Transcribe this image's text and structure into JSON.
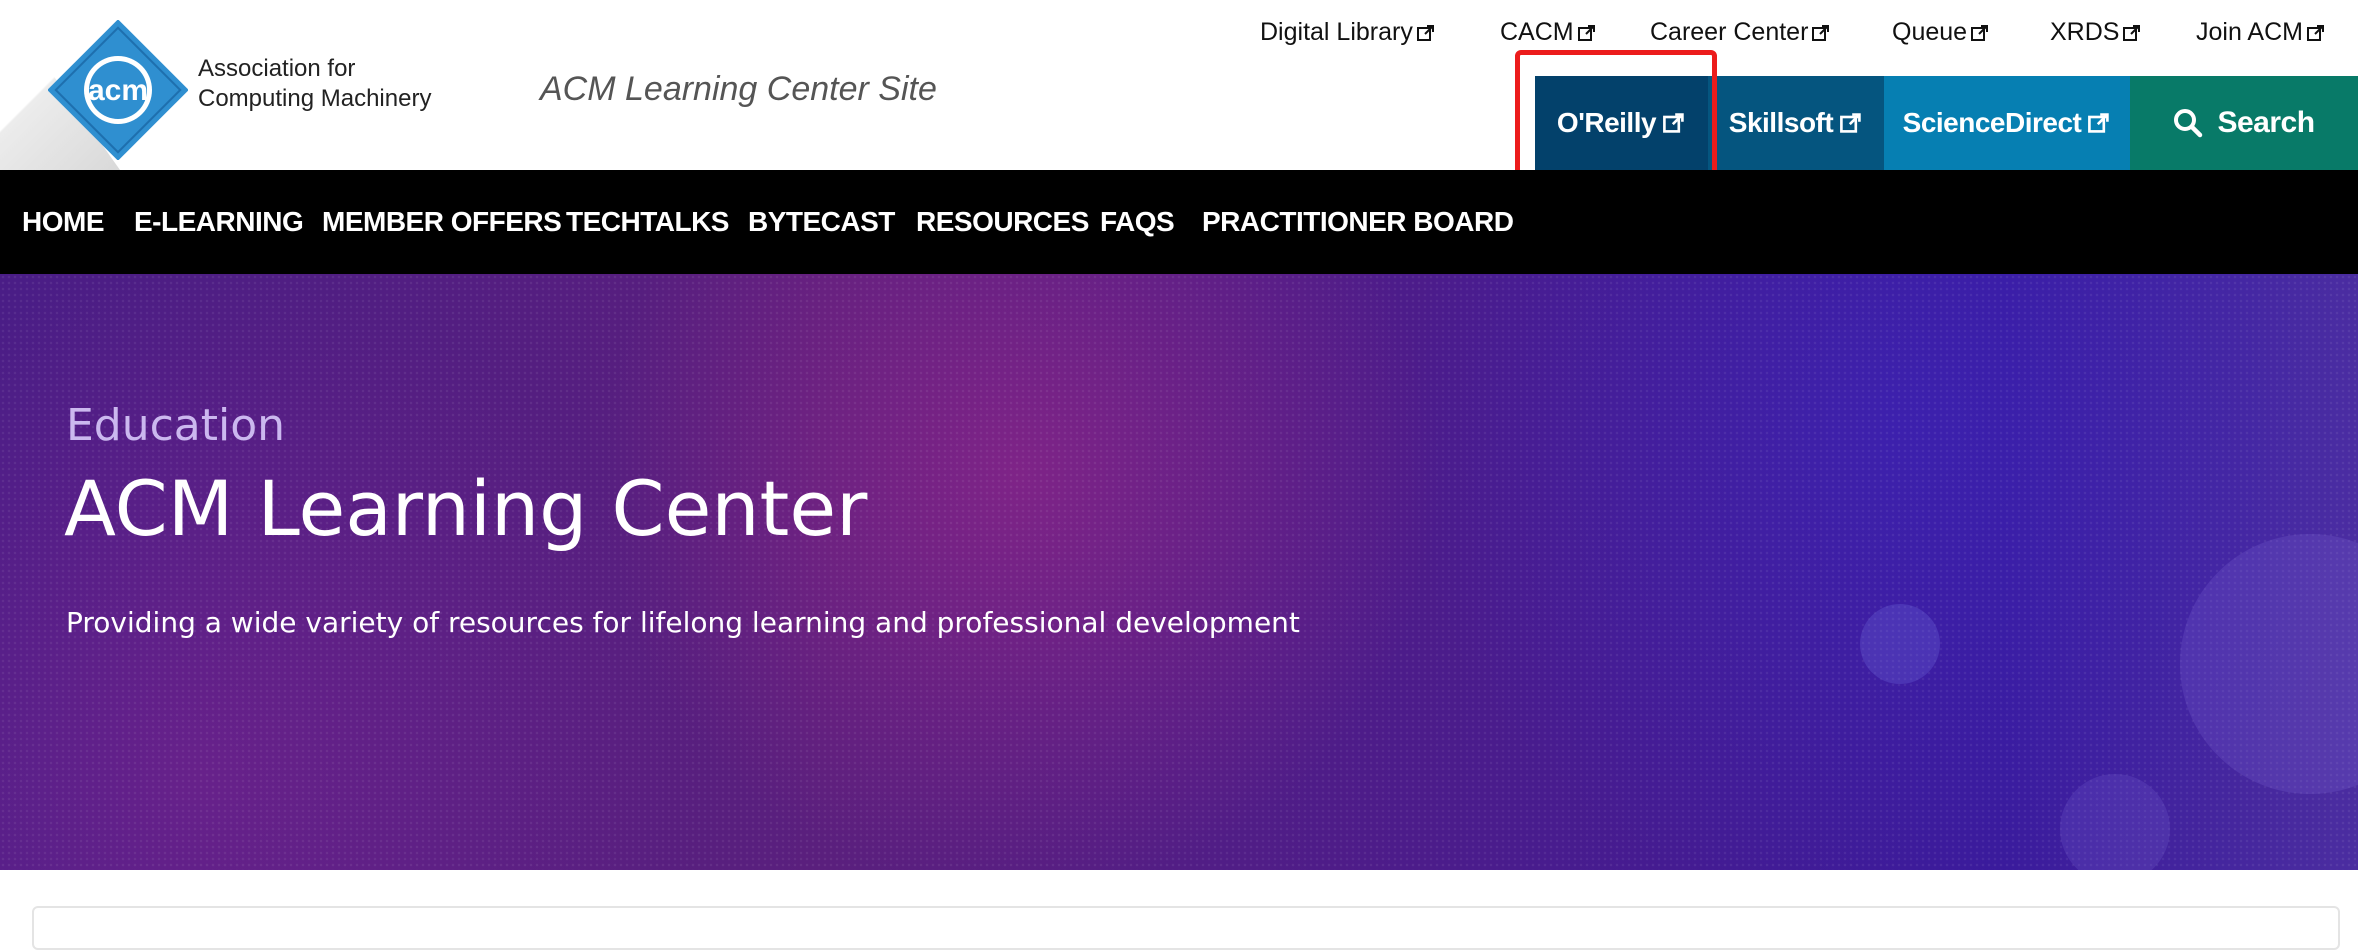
{
  "header": {
    "logo": {
      "mark_text": "acm",
      "line1": "Association for",
      "line2": "Computing Machinery"
    },
    "site_tag": "ACM Learning Center Site",
    "top_links": [
      {
        "label": "Digital Library"
      },
      {
        "label": "CACM"
      },
      {
        "label": "Career Center"
      },
      {
        "label": "Queue"
      },
      {
        "label": "XRDS"
      },
      {
        "label": "Join ACM"
      }
    ],
    "partners": [
      {
        "label": "O'Reilly",
        "color": "#03416b"
      },
      {
        "label": "Skillsoft",
        "color": "#05557f"
      },
      {
        "label": "ScienceDirect",
        "color": "#067fb2"
      }
    ],
    "search_label": "Search",
    "search_color": "#087a68"
  },
  "nav": {
    "items": [
      {
        "label": "HOME"
      },
      {
        "label": "E-LEARNING"
      },
      {
        "label": "MEMBER OFFERS"
      },
      {
        "label": "TECHTALKS"
      },
      {
        "label": "BYTECAST"
      },
      {
        "label": "RESOURCES"
      },
      {
        "label": "FAQS"
      },
      {
        "label": "PRACTITIONER BOARD"
      }
    ]
  },
  "hero": {
    "kicker": "Education",
    "title": "ACM Learning Center",
    "subtitle": "Providing a wide variety of resources for lifelong learning and professional development"
  },
  "colors": {
    "nav_bg": "#000000",
    "highlight": "#ec1c1c",
    "logo_blue": "#2f8fd0"
  }
}
